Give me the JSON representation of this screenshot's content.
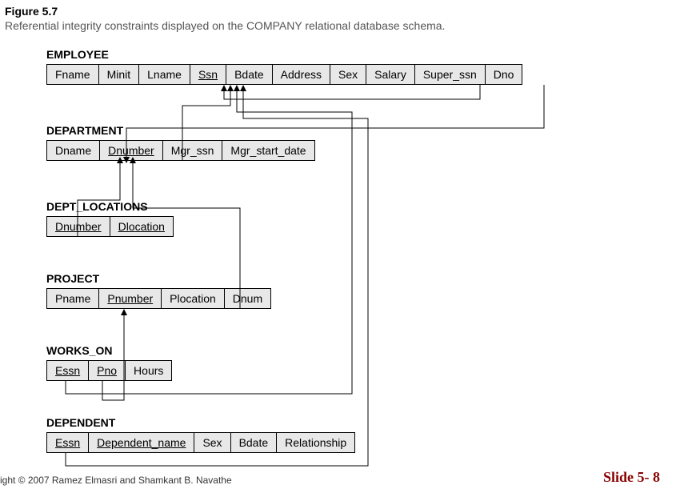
{
  "figure": {
    "title": "Figure 5.7",
    "caption": "Referential integrity constraints displayed on the COMPANY relational database schema."
  },
  "tables": {
    "employee": {
      "name": "EMPLOYEE",
      "cols": [
        "Fname",
        "Minit",
        "Lname",
        "Ssn",
        "Bdate",
        "Address",
        "Sex",
        "Salary",
        "Super_ssn",
        "Dno"
      ]
    },
    "department": {
      "name": "DEPARTMENT",
      "cols": [
        "Dname",
        "Dnumber",
        "Mgr_ssn",
        "Mgr_start_date"
      ]
    },
    "dept_locations": {
      "name": "DEPT_LOCATIONS",
      "cols": [
        "Dnumber",
        "Dlocation"
      ]
    },
    "project": {
      "name": "PROJECT",
      "cols": [
        "Pname",
        "Pnumber",
        "Plocation",
        "Dnum"
      ]
    },
    "works_on": {
      "name": "WORKS_ON",
      "cols": [
        "Essn",
        "Pno",
        "Hours"
      ]
    },
    "dependent": {
      "name": "DEPENDENT",
      "cols": [
        "Essn",
        "Dependent_name",
        "Sex",
        "Bdate",
        "Relationship"
      ]
    }
  },
  "primary_keys": {
    "employee": [
      "Ssn"
    ],
    "department": [
      "Dnumber"
    ],
    "dept_locations": [
      "Dnumber",
      "Dlocation"
    ],
    "project": [
      "Pnumber"
    ],
    "works_on": [
      "Essn",
      "Pno"
    ],
    "dependent": [
      "Essn",
      "Dependent_name"
    ]
  },
  "foreign_keys": [
    {
      "from": "EMPLOYEE.Super_ssn",
      "to": "EMPLOYEE.Ssn"
    },
    {
      "from": "EMPLOYEE.Dno",
      "to": "DEPARTMENT.Dnumber"
    },
    {
      "from": "DEPARTMENT.Mgr_ssn",
      "to": "EMPLOYEE.Ssn"
    },
    {
      "from": "DEPT_LOCATIONS.Dnumber",
      "to": "DEPARTMENT.Dnumber"
    },
    {
      "from": "PROJECT.Dnum",
      "to": "DEPARTMENT.Dnumber"
    },
    {
      "from": "WORKS_ON.Essn",
      "to": "EMPLOYEE.Ssn"
    },
    {
      "from": "WORKS_ON.Pno",
      "to": "PROJECT.Pnumber"
    },
    {
      "from": "DEPENDENT.Essn",
      "to": "EMPLOYEE.Ssn"
    }
  ],
  "footer": {
    "left": "ight © 2007 Ramez Elmasri and Shamkant B. Navathe",
    "right": "Slide 5- 8"
  }
}
